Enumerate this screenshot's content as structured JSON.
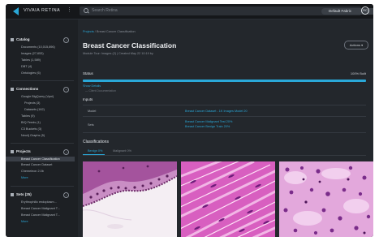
{
  "app": {
    "brand": "VIVAIA RETINA",
    "menu_icon": "more-vert-icon"
  },
  "search": {
    "placeholder": "Search Retina"
  },
  "fabric": {
    "label": "Default Fabric",
    "caret": "▾"
  },
  "user": {
    "initials": "RC"
  },
  "sidebar": {
    "catalog": {
      "title": "Catalog",
      "items": [
        "Documents (10,015,896)",
        "Images (27,653)",
        "Tables (1,589)",
        "DBT (4)",
        "Ontologies (6)"
      ]
    },
    "connections": {
      "title": "Connections",
      "items": [
        "Google BigQuery (Vpni)",
        "Projects (3)",
        "Datasets (162)",
        "Tables (9)",
        "BIQ Feeds (1)",
        "C3 Buckets (3)",
        "Neo4j Graphs (5)"
      ]
    },
    "projects": {
      "title": "Projects",
      "items": [
        "Breast Cancer Classification",
        "Breast Cancer Dataset",
        "Chemeleon 2.0b"
      ],
      "more": "More",
      "selected_index": 0
    },
    "sets": {
      "title": "Sets (25)",
      "items": [
        "Erythrophilic endoplasm...",
        "Breast Cancer Malignant T...",
        "Breast Cancer Malignant T..."
      ],
      "more": "More"
    }
  },
  "main": {
    "breadcrumb": {
      "root": "Projects",
      "sep": "/",
      "current": "Breast Cancer Classification"
    },
    "title": "Breast Cancer Classification",
    "subtitle": "Module Tour: Images (2)  |  Created May 22 10:19 by",
    "actions_label": "Actions  ▾",
    "status": {
      "label": "Status",
      "value": "100% Built",
      "progress": 1.0
    },
    "show_details": "Show Details",
    "details_sub": "— Client Documentation",
    "inputs": {
      "label": "Inputs",
      "rows": [
        {
          "key": "Model",
          "values": [
            "Breast Cancer Dataset - 1K Images Model 20"
          ]
        },
        {
          "key": "Sets",
          "values": [
            "Breast Cancer Malignant Test 20%",
            "Breast Cancer Benign Train 20%"
          ]
        }
      ]
    },
    "classifications": {
      "label": "Classifications",
      "tabs": [
        "Benign 0%",
        "Malignant 0%"
      ],
      "active_tab": 0
    }
  },
  "colors": {
    "accent": "#2aa8d8",
    "background": "#1d2024",
    "panel": "#23272c"
  }
}
